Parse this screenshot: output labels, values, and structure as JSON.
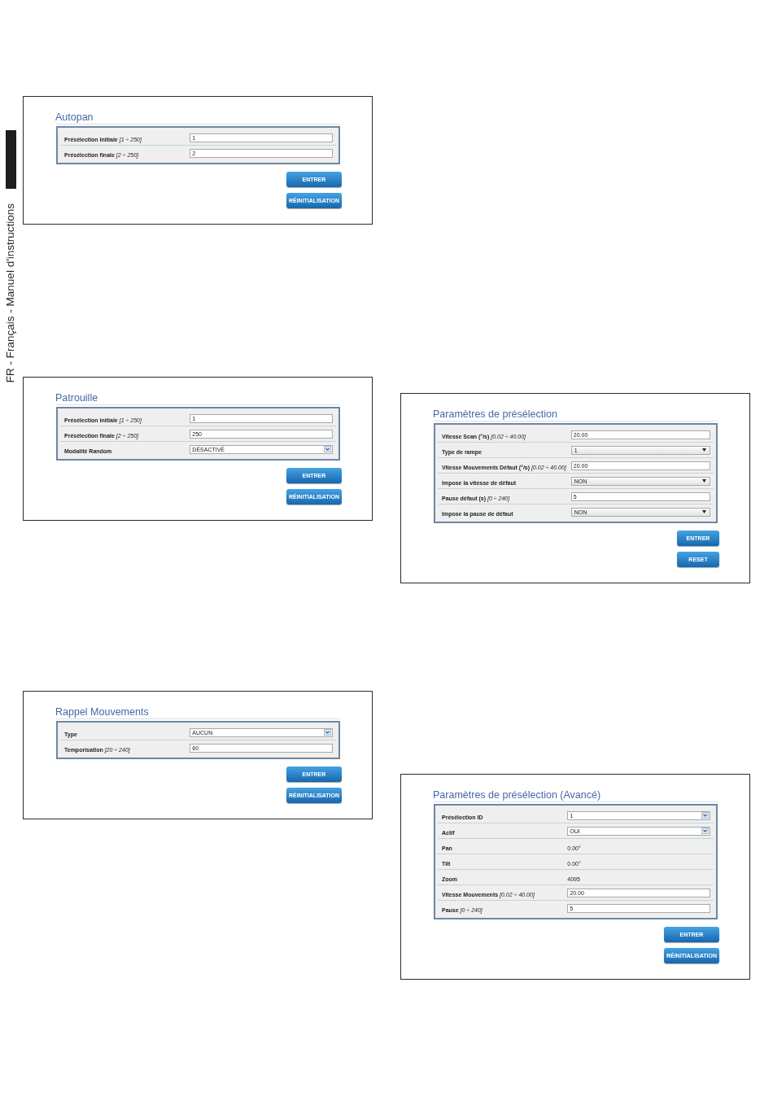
{
  "side_label": "FR - Français - Manuel d'instructions",
  "left_column": {
    "panels": [
      {
        "title": "Autopan",
        "fields": [
          {
            "label": "Présélection initiale *[1 ÷ 250]*",
            "kind": "input",
            "value": "1"
          },
          {
            "label": "Présélection finale *[2 ÷ 250]*",
            "kind": "input",
            "value": "2"
          }
        ],
        "buttons": [
          "ENTRER",
          "RÉINITIALISATION"
        ]
      },
      {
        "title": "Patrouille",
        "fields": [
          {
            "label": "Présélection initiale *[1 ÷ 250]*",
            "kind": "input",
            "value": "1"
          },
          {
            "label": "Présélection finale *[2 ÷ 250]*",
            "kind": "input",
            "value": "250"
          },
          {
            "label": "Modalité Random",
            "kind": "select",
            "value": "DÉSACTIVÉ"
          }
        ],
        "buttons": [
          "ENTRER",
          "RÉINITIALISATION"
        ]
      },
      {
        "title": "Rappel Mouvements",
        "fields": [
          {
            "label": "Type",
            "kind": "select",
            "value": "AUCUN"
          },
          {
            "label": "Temporisation *[20 ÷ 240]*",
            "kind": "input",
            "value": "60"
          }
        ],
        "buttons": [
          "ENTRER",
          "RÉINITIALISATION"
        ]
      }
    ]
  },
  "right_column": {
    "panels": [
      {
        "title": "Paramètres de présélection",
        "fields": [
          {
            "label": "Vitesse Scan (°/s) *[0.02 ÷ 40.00]*",
            "kind": "input",
            "value": "20.00"
          },
          {
            "label": "Type de rampe",
            "kind": "picker",
            "value": "1"
          },
          {
            "label": "Vitesse Mouvements Défaut (°/s) *[0.02 ÷ 40.00]*",
            "kind": "input",
            "value": "20.00"
          },
          {
            "label": "Impose la vitesse de défaut",
            "kind": "picker",
            "value": "NON"
          },
          {
            "label": "Pause défaut (s) *[0 ÷ 240]*",
            "kind": "input",
            "value": "5"
          },
          {
            "label": "Impose la pause de défaut",
            "kind": "picker",
            "value": "NON"
          }
        ],
        "buttons": [
          "ENTRER",
          "RESET"
        ]
      },
      {
        "title": "Paramètres de présélection (Avancé)",
        "fields": [
          {
            "label": "Présélection ID",
            "kind": "select",
            "value": "1"
          },
          {
            "label": "Actif",
            "kind": "select",
            "value": "OUI"
          },
          {
            "label": "Pan",
            "kind": "text",
            "value": "0.00°"
          },
          {
            "label": "Tilt",
            "kind": "text",
            "value": "0.00°"
          },
          {
            "label": "Zoom",
            "kind": "text",
            "value": "4095"
          },
          {
            "label": "Vitesse Mouvements *[0.02 ÷ 40.00]*",
            "kind": "input",
            "value": "20.00"
          },
          {
            "label": "Pause *[0 ÷ 240]*",
            "kind": "input",
            "value": "5"
          }
        ],
        "buttons": [
          "ENTRER",
          "RÉINITIALISATION"
        ]
      }
    ]
  }
}
